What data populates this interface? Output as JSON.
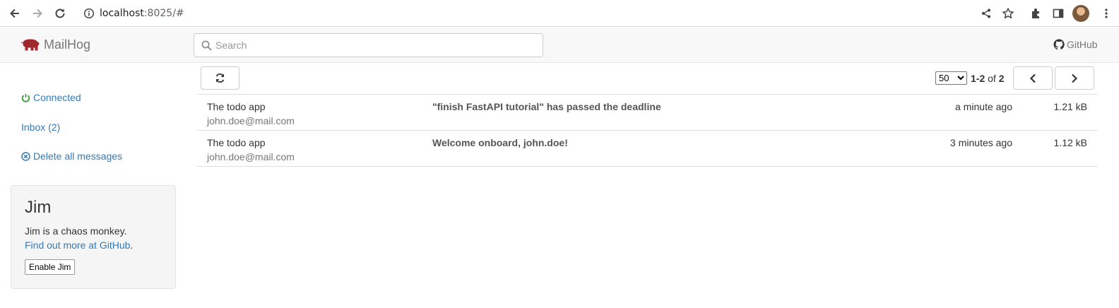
{
  "browser": {
    "url_host": "localhost",
    "url_rest": ":8025/#"
  },
  "header": {
    "brand": "MailHog",
    "search_placeholder": "Search",
    "github_label": "GitHub"
  },
  "sidebar": {
    "connected_label": "Connected",
    "inbox_label": "Inbox (2)",
    "delete_label": "Delete all messages"
  },
  "jim": {
    "title": "Jim",
    "description": "Jim is a chaos monkey.",
    "link_text": "Find out more at GitHub",
    "link_suffix": ".",
    "button_label": "Enable Jim"
  },
  "pager": {
    "page_size": "50",
    "range": "1-2",
    "of_label": "of",
    "total": "2"
  },
  "messages": [
    {
      "from_name": "The todo app",
      "from_email": "john.doe@mail.com",
      "subject": "\"finish FastAPI tutorial\" has passed the deadline",
      "time": "a minute ago",
      "size": "1.21 kB"
    },
    {
      "from_name": "The todo app",
      "from_email": "john.doe@mail.com",
      "subject": "Welcome onboard, john.doe!",
      "time": "3 minutes ago",
      "size": "1.12 kB"
    }
  ],
  "colors": {
    "link": "#337ab7",
    "connected": "#3c9a3c",
    "brand_pig": "#a0282c"
  }
}
